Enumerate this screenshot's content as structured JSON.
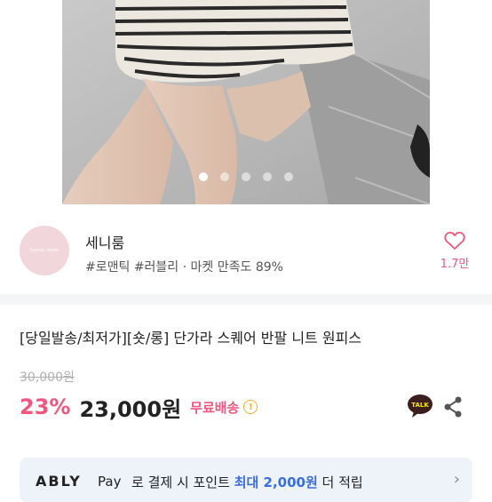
{
  "carousel": {
    "slide_count": 5,
    "active_index": 0
  },
  "seller": {
    "avatar_text": "Sunny room",
    "name": "세니룸",
    "tags": "#로맨틱 #러블리 · 마켓 만족도 89%",
    "like_count": "1.7만"
  },
  "product": {
    "title": "[당일발송/최저가][숏/롱] 단가라 스퀘어 반팔 니트 원피스",
    "original_price": "30,000원",
    "discount": "23%",
    "price": "23,000원",
    "shipping": "무료배송",
    "talk_label": "TALK"
  },
  "banner": {
    "logo": "ABLY",
    "pay": "Pay",
    "text_before": "로 결제 시 포인트 ",
    "text_accent": "최대 2,000원",
    "text_after": " 더 적립"
  },
  "colors": {
    "accent_pink": "#f0577f",
    "accent_blue": "#3b6fd8",
    "kakao_yellow": "#f7e600"
  }
}
